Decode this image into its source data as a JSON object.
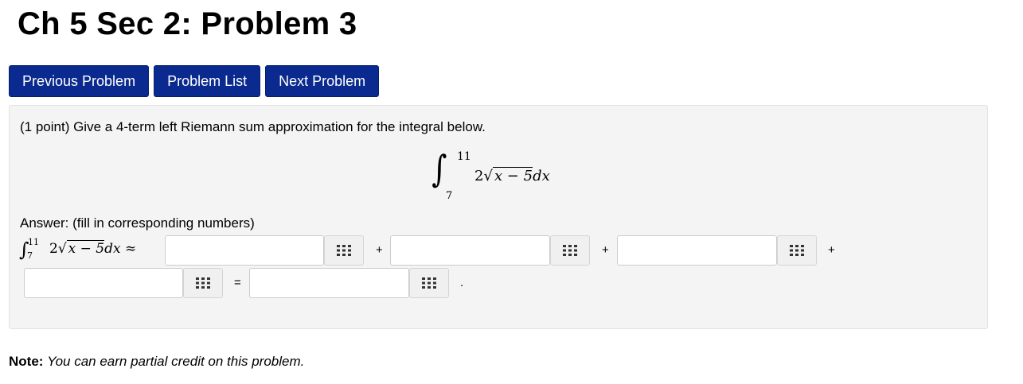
{
  "page": {
    "title": "Ch 5 Sec 2: Problem 3"
  },
  "nav": {
    "previous": "Previous Problem",
    "list": "Problem List",
    "next": "Next Problem"
  },
  "problem": {
    "statement": "(1 point) Give a 4-term left Riemann sum approximation for the integral below.",
    "integral": {
      "upper": "11",
      "lower": "7",
      "coeff": "2",
      "radicand": "x − 5",
      "differential": "dx"
    },
    "answer_label": "Answer: (fill in corresponding numbers)",
    "approx_symbol": "≈",
    "operators": {
      "plus": "+",
      "equals": "=",
      "period": "."
    },
    "inputs": [
      {
        "value": ""
      },
      {
        "value": ""
      },
      {
        "value": ""
      },
      {
        "value": ""
      },
      {
        "value": ""
      }
    ],
    "keyboard_icon": "keyboard-grid-icon"
  },
  "note": {
    "label": "Note:",
    "text": "You can earn partial credit on this problem."
  }
}
